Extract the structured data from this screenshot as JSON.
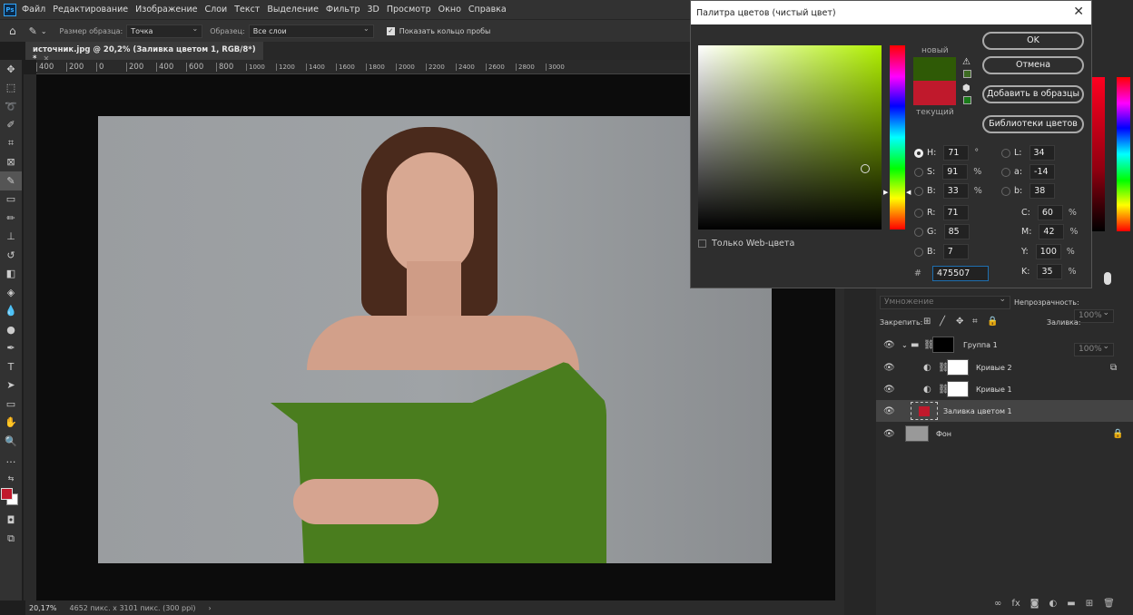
{
  "menu": {
    "items": [
      "Файл",
      "Редактирование",
      "Изображение",
      "Слои",
      "Текст",
      "Выделение",
      "Фильтр",
      "3D",
      "Просмотр",
      "Окно",
      "Справка"
    ]
  },
  "options": {
    "sample_size_label": "Размер образца:",
    "sample_size_value": "Точка",
    "sample_label": "Образец:",
    "sample_value": "Все слои",
    "show_ring_label": "Показать кольцо пробы",
    "show_ring_checked": true
  },
  "document": {
    "tab_title": "источник.jpg @ 20,2% (Заливка цветом 1, RGB/8*) *",
    "ruler_ticks": [
      "400",
      "200",
      "0",
      "200",
      "400",
      "600",
      "800",
      "1000",
      "1200",
      "1400",
      "1600",
      "1800",
      "2000",
      "2200",
      "2400",
      "2600",
      "2800",
      "3000"
    ]
  },
  "status": {
    "zoom": "20,17%",
    "dimensions": "4652 пикс. x 3101 пикс. (300 ppi)"
  },
  "color_picker": {
    "title": "Палитра цветов (чистый цвет)",
    "new_label": "новый",
    "current_label": "текущий",
    "new_color": "#475507",
    "current_color": "#c0192c",
    "ok": "OK",
    "cancel": "Отмена",
    "add_to_swatches": "Добавить в образцы",
    "color_libraries": "Библиотеки цветов",
    "web_only_label": "Только Web-цвета",
    "fields": {
      "H": {
        "label": "H:",
        "value": "71",
        "unit": "°"
      },
      "S": {
        "label": "S:",
        "value": "91",
        "unit": "%"
      },
      "Bv": {
        "label": "B:",
        "value": "33",
        "unit": "%"
      },
      "R": {
        "label": "R:",
        "value": "71"
      },
      "G": {
        "label": "G:",
        "value": "85"
      },
      "Bc": {
        "label": "B:",
        "value": "7"
      },
      "L": {
        "label": "L:",
        "value": "34"
      },
      "a": {
        "label": "a:",
        "value": "-14"
      },
      "b": {
        "label": "b:",
        "value": "38"
      },
      "C": {
        "label": "C:",
        "value": "60",
        "unit": "%"
      },
      "M": {
        "label": "M:",
        "value": "42",
        "unit": "%"
      },
      "Y": {
        "label": "Y:",
        "value": "100",
        "unit": "%"
      },
      "K": {
        "label": "K:",
        "value": "35",
        "unit": "%"
      }
    },
    "hex_label": "#",
    "hex": "475507"
  },
  "layers": {
    "blend_mode": "Умножение",
    "opacity_label": "Непрозрачность:",
    "opacity": "100%",
    "lock_label": "Закрепить:",
    "fill_label": "Заливка:",
    "fill": "100%",
    "items": [
      {
        "name": "Группа 1"
      },
      {
        "name": "Кривые 2"
      },
      {
        "name": "Кривые 1"
      },
      {
        "name": "Заливка цветом 1",
        "selected": true
      },
      {
        "name": "Фон",
        "locked": true
      }
    ]
  },
  "colors": {
    "foreground": "#c0192c",
    "background": "#ffffff"
  }
}
